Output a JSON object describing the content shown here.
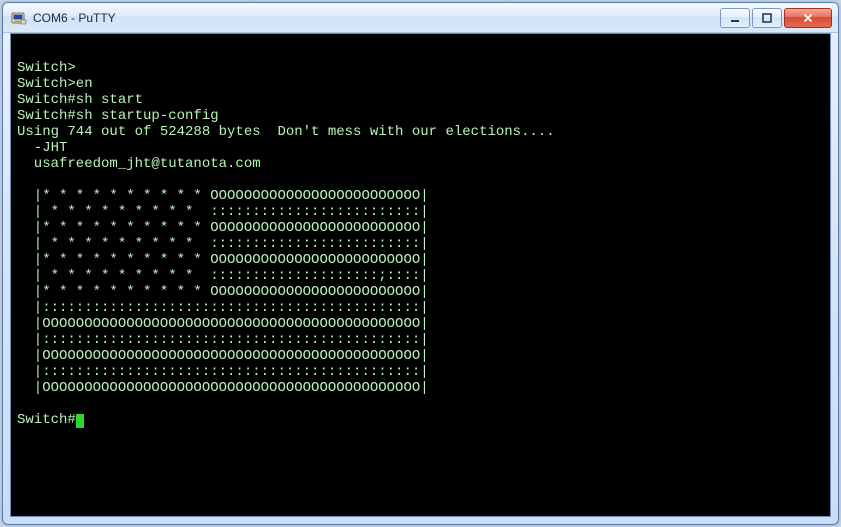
{
  "window": {
    "title": "COM6 - PuTTY"
  },
  "terminal": {
    "lines": [
      "",
      "Switch>",
      "Switch>en",
      "Switch#sh start",
      "Switch#sh startup-config",
      "Using 744 out of 524288 bytes  Don't mess with our elections....",
      "  -JHT",
      "  usafreedom_jht@tutanota.com",
      "",
      "  |* * * * * * * * * * OOOOOOOOOOOOOOOOOOOOOOOOO|",
      "  | * * * * * * * * *  :::::::::::::::::::::::::|",
      "  |* * * * * * * * * * OOOOOOOOOOOOOOOOOOOOOOOOO|",
      "  | * * * * * * * * *  :::::::::::::::::::::::::|",
      "  |* * * * * * * * * * OOOOOOOOOOOOOOOOOOOOOOOOO|",
      "  | * * * * * * * * *  ::::::::::::::::::::;::::|",
      "  |* * * * * * * * * * OOOOOOOOOOOOOOOOOOOOOOOOO|",
      "  |:::::::::::::::::::::::::::::::::::::::::::::|",
      "  |OOOOOOOOOOOOOOOOOOOOOOOOOOOOOOOOOOOOOOOOOOOOO|",
      "  |:::::::::::::::::::::::::::::::::::::::::::::|",
      "  |OOOOOOOOOOOOOOOOOOOOOOOOOOOOOOOOOOOOOOOOOOOOO|",
      "  |:::::::::::::::::::::::::::::::::::::::::::::|",
      "  |OOOOOOOOOOOOOOOOOOOOOOOOOOOOOOOOOOOOOOOOOOOOO|",
      ""
    ],
    "prompt": "Switch#"
  }
}
